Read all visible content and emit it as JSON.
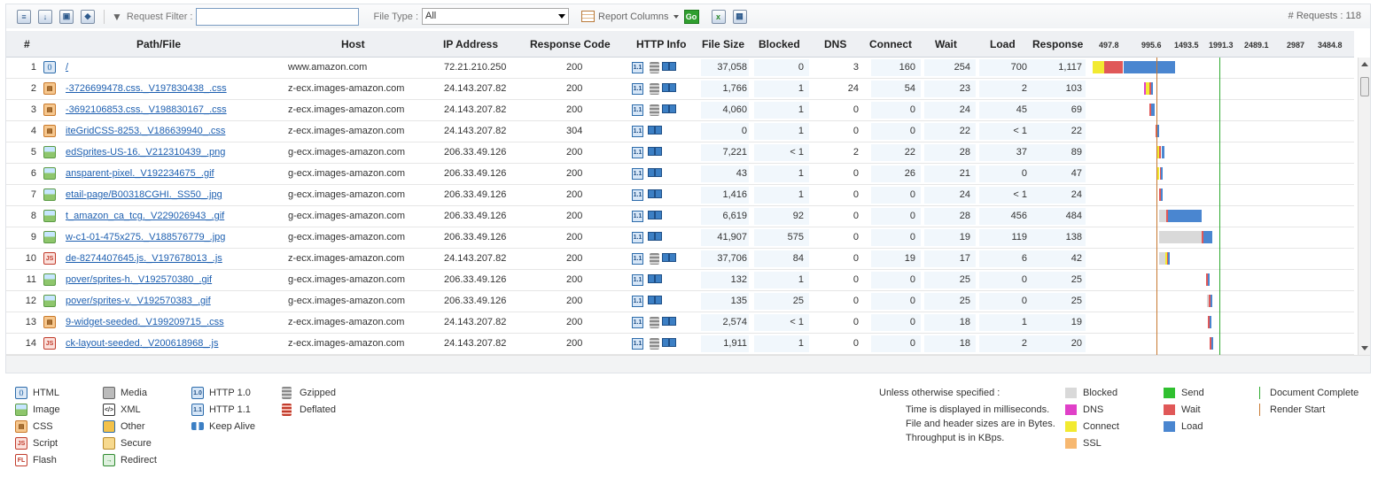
{
  "toolbar": {
    "request_filter_label": "Request Filter :",
    "request_filter_value": "",
    "file_type_label": "File Type :",
    "file_type_value": "All",
    "report_columns_label": "Report Columns",
    "go_label": "Go",
    "requests_count": "# Requests : 118"
  },
  "columns": {
    "index": "#",
    "path": "Path/File",
    "host": "Host",
    "ip": "IP Address",
    "response_code": "Response Code",
    "http_info": "HTTP Info",
    "file_size": "File Size",
    "blocked": "Blocked",
    "dns": "DNS",
    "connect": "Connect",
    "wait": "Wait",
    "load": "Load",
    "response": "Response"
  },
  "timeline_ticks": [
    "497.8",
    "995.6",
    "1493.5",
    "1991.3",
    "2489.1",
    "2987",
    "3484.8"
  ],
  "colors": {
    "blocked": "#d9d9d9",
    "dns": "#e040c8",
    "connect": "#f2ea30",
    "ssl": "#f7b870",
    "send": "#30c030",
    "wait": "#e05858",
    "load": "#4a86d0",
    "document_complete": "#2faa2f",
    "render_start": "#c87830"
  },
  "rows": [
    {
      "index": "1",
      "type": "html",
      "path": "/",
      "host": "www.amazon.com",
      "ip": "72.21.210.250",
      "code": "200",
      "http": [
        "http11",
        "gzipped",
        "keepalive"
      ],
      "size": "37,058",
      "blocked": "0",
      "dns": "3",
      "connect": "160",
      "wait": "254",
      "load": "700",
      "response": "1,117",
      "wf_start": 0,
      "wf_connect": 160,
      "wf_wait": 254,
      "wf_load": 700
    },
    {
      "index": "2",
      "type": "css",
      "path": "-3726699478.css._V197830438_.css",
      "host": "z-ecx.images-amazon.com",
      "ip": "24.143.207.82",
      "code": "200",
      "http": [
        "http11",
        "gzipped",
        "keepalive"
      ],
      "size": "1,766",
      "blocked": "1",
      "dns": "24",
      "connect": "54",
      "wait": "23",
      "load": "2",
      "response": "103",
      "wf_start": 690,
      "wf_dns": 24,
      "wf_connect": 54,
      "wf_wait": 23,
      "wf_load": 2
    },
    {
      "index": "3",
      "type": "css",
      "path": "-3692106853.css._V198830167_.css",
      "host": "z-ecx.images-amazon.com",
      "ip": "24.143.207.82",
      "code": "200",
      "http": [
        "http11",
        "gzipped",
        "keepalive"
      ],
      "size": "4,060",
      "blocked": "1",
      "dns": "0",
      "connect": "0",
      "wait": "24",
      "load": "45",
      "response": "69",
      "wf_start": 770,
      "wf_wait": 24,
      "wf_load": 45
    },
    {
      "index": "4",
      "type": "css",
      "path": "iteGridCSS-8253._V186639940_.css",
      "host": "z-ecx.images-amazon.com",
      "ip": "24.143.207.82",
      "code": "304",
      "http": [
        "http11",
        "keepalive"
      ],
      "size": "0",
      "blocked": "1",
      "dns": "0",
      "connect": "0",
      "wait": "22",
      "load": "< 1",
      "response": "22",
      "wf_start": 850,
      "wf_wait": 22,
      "wf_load": 0
    },
    {
      "index": "5",
      "type": "image",
      "path": "edSprites-US-16._V212310439_.png",
      "host": "g-ecx.images-amazon.com",
      "ip": "206.33.49.126",
      "code": "200",
      "http": [
        "http11",
        "keepalive"
      ],
      "size": "7,221",
      "blocked": "< 1",
      "dns": "2",
      "connect": "22",
      "wait": "28",
      "load": "37",
      "response": "89",
      "wf_start": 880,
      "wf_connect": 22,
      "wf_wait": 28,
      "wf_load": 37
    },
    {
      "index": "6",
      "type": "image",
      "path": "ansparent-pixel._V192234675_.gif",
      "host": "g-ecx.images-amazon.com",
      "ip": "206.33.49.126",
      "code": "200",
      "http": [
        "http11",
        "keepalive"
      ],
      "size": "43",
      "blocked": "1",
      "dns": "0",
      "connect": "26",
      "wait": "21",
      "load": "0",
      "response": "47",
      "wf_start": 880,
      "wf_connect": 26,
      "wf_wait": 21,
      "wf_load": 0
    },
    {
      "index": "7",
      "type": "image",
      "path": "etail-page/B00318CGHI._SS50_.jpg",
      "host": "g-ecx.images-amazon.com",
      "ip": "206.33.49.126",
      "code": "200",
      "http": [
        "http11",
        "keepalive"
      ],
      "size": "1,416",
      "blocked": "1",
      "dns": "0",
      "connect": "0",
      "wait": "24",
      "load": "< 1",
      "response": "24",
      "wf_start": 900,
      "wf_wait": 24,
      "wf_load": 0
    },
    {
      "index": "8",
      "type": "image",
      "path": "t_amazon_ca_tcg._V229026943_.gif",
      "host": "g-ecx.images-amazon.com",
      "ip": "206.33.49.126",
      "code": "200",
      "http": [
        "http11",
        "keepalive"
      ],
      "size": "6,619",
      "blocked": "92",
      "dns": "0",
      "connect": "0",
      "wait": "28",
      "load": "456",
      "response": "484",
      "wf_start": 900,
      "wf_blocked": 92,
      "wf_wait": 28,
      "wf_load": 456
    },
    {
      "index": "9",
      "type": "image",
      "path": "w-c1-01-475x275._V188576779_.jpg",
      "host": "g-ecx.images-amazon.com",
      "ip": "206.33.49.126",
      "code": "200",
      "http": [
        "http11",
        "keepalive"
      ],
      "size": "41,907",
      "blocked": "575",
      "dns": "0",
      "connect": "0",
      "wait": "19",
      "load": "119",
      "response": "138",
      "wf_start": 905,
      "wf_blocked": 575,
      "wf_wait": 19,
      "wf_load": 119
    },
    {
      "index": "10",
      "type": "script",
      "path": "de-8274407645.js._V197678013_.js",
      "host": "z-ecx.images-amazon.com",
      "ip": "24.143.207.82",
      "code": "200",
      "http": [
        "http11",
        "gzipped",
        "keepalive"
      ],
      "size": "37,706",
      "blocked": "84",
      "dns": "0",
      "connect": "19",
      "wait": "17",
      "load": "6",
      "response": "42",
      "wf_start": 905,
      "wf_blocked": 84,
      "wf_connect": 19,
      "wf_wait": 17,
      "wf_load": 6
    },
    {
      "index": "11",
      "type": "image",
      "path": "pover/sprites-h._V192570380_.gif",
      "host": "g-ecx.images-amazon.com",
      "ip": "206.33.49.126",
      "code": "200",
      "http": [
        "http11",
        "keepalive"
      ],
      "size": "132",
      "blocked": "1",
      "dns": "0",
      "connect": "0",
      "wait": "25",
      "load": "0",
      "response": "25",
      "wf_start": 1540,
      "wf_wait": 25,
      "wf_load": 0
    },
    {
      "index": "12",
      "type": "image",
      "path": "pover/sprites-v._V192570383_.gif",
      "host": "g-ecx.images-amazon.com",
      "ip": "206.33.49.126",
      "code": "200",
      "http": [
        "http11",
        "keepalive"
      ],
      "size": "135",
      "blocked": "25",
      "dns": "0",
      "connect": "0",
      "wait": "25",
      "load": "0",
      "response": "25",
      "wf_start": 1545,
      "wf_blocked": 25,
      "wf_wait": 25,
      "wf_load": 0
    },
    {
      "index": "13",
      "type": "css",
      "path": "9-widget-seeded._V199209715_.css",
      "host": "z-ecx.images-amazon.com",
      "ip": "24.143.207.82",
      "code": "200",
      "http": [
        "http11",
        "gzipped",
        "keepalive"
      ],
      "size": "2,574",
      "blocked": "< 1",
      "dns": "0",
      "connect": "0",
      "wait": "18",
      "load": "1",
      "response": "19",
      "wf_start": 1560,
      "wf_wait": 18,
      "wf_load": 1
    },
    {
      "index": "14",
      "type": "script",
      "path": "ck-layout-seeded._V200618968_.js",
      "host": "z-ecx.images-amazon.com",
      "ip": "24.143.207.82",
      "code": "200",
      "http": [
        "http11",
        "gzipped",
        "keepalive"
      ],
      "size": "1,911",
      "blocked": "1",
      "dns": "0",
      "connect": "0",
      "wait": "18",
      "load": "2",
      "response": "20",
      "wf_start": 1585,
      "wf_wait": 18,
      "wf_load": 2
    }
  ],
  "markers": {
    "render_start": 860,
    "document_complete": 1720
  },
  "legend": {
    "types": [
      {
        "label": "HTML",
        "icon": "html-icon"
      },
      {
        "label": "Image",
        "icon": "image-icon"
      },
      {
        "label": "CSS",
        "icon": "css-icon"
      },
      {
        "label": "Script",
        "icon": "script-icon"
      },
      {
        "label": "Flash",
        "icon": "flash-icon"
      },
      {
        "label": "Media",
        "icon": "media-icon"
      },
      {
        "label": "XML",
        "icon": "xml-icon"
      },
      {
        "label": "Other",
        "icon": "other-icon"
      },
      {
        "label": "Secure",
        "icon": "secure-icon"
      },
      {
        "label": "Redirect",
        "icon": "redirect-icon"
      }
    ],
    "http": [
      {
        "label": "HTTP 1.0",
        "icon": "http10-icon",
        "glyph": "1.0"
      },
      {
        "label": "HTTP 1.1",
        "icon": "http11-icon",
        "glyph": "1.1"
      },
      {
        "label": "Keep Alive",
        "icon": "keepalive-icon",
        "glyph": ""
      },
      {
        "label": "Gzipped",
        "icon": "gzipped-icon",
        "glyph": ""
      },
      {
        "label": "Deflated",
        "icon": "deflated-icon",
        "glyph": ""
      }
    ],
    "notes_title": "Unless otherwise specified :",
    "notes": [
      "Time is displayed in milliseconds.",
      "File and header sizes are in Bytes.",
      "Throughput is in KBps."
    ],
    "timings": [
      {
        "label": "Blocked",
        "color": "#d9d9d9"
      },
      {
        "label": "DNS",
        "color": "#e040c8"
      },
      {
        "label": "Connect",
        "color": "#f2ea30"
      },
      {
        "label": "SSL",
        "color": "#f7b870"
      },
      {
        "label": "Send",
        "color": "#30c030"
      },
      {
        "label": "Wait",
        "color": "#e05858"
      },
      {
        "label": "Load",
        "color": "#4a86d0"
      }
    ],
    "markers": [
      {
        "label": "Document Complete",
        "color": "#2faa2f"
      },
      {
        "label": "Render Start",
        "color": "#c87830"
      }
    ]
  }
}
